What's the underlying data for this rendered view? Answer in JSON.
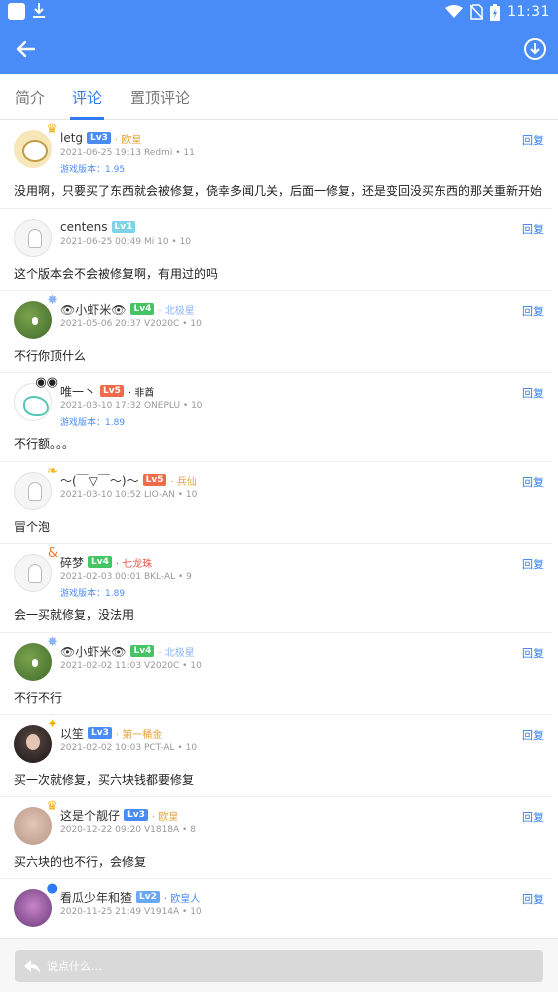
{
  "status_bar": {
    "time": "11:31"
  },
  "tabs": [
    "简介",
    "评论",
    "置顶评论"
  ],
  "active_tab": "评论",
  "reply_label": "回复",
  "input": {
    "placeholder": "说点什么..."
  },
  "colors": {
    "primary": "#4a8cf7",
    "accent": "#2f7bf2",
    "gold": "#e6a23c",
    "black": "#222222",
    "red": "#e35b4b"
  },
  "comments": [
    {
      "user": "letg",
      "level": "Lv3",
      "level_color": "#4a8cf7",
      "title": "· 欧皇",
      "title_color": "#e6a23c",
      "meta": "2021-06-25 19:13 Redmi  • 11",
      "version": "游戏版本：1.95",
      "content": "没用啊，只要买了东西就会被修复，侥幸多闻几关，后面一修复，还是变回没买东西的那关重新开始",
      "avatar": "cartoon",
      "decor": "crown"
    },
    {
      "user": "centens",
      "level": "Lv1",
      "level_color": "#7fd3e6",
      "title": "",
      "title_color": "#999999",
      "meta": "2021-06-25 00:49 Mi 10 • 10",
      "version": "",
      "content": "这个版本会不会被修复啊，有用过的吗",
      "avatar": "ghost",
      "decor": ""
    },
    {
      "user": "👁小虾米👁",
      "level": "Lv4",
      "level_color": "#45c463",
      "title": "· 北极星",
      "title_color": "#8ab4f8",
      "meta": "2021-05-06 20:37 V2020C • 10",
      "version": "",
      "content": "不行你顶什么",
      "avatar": "green",
      "decor": "star"
    },
    {
      "user": "唯一丶",
      "level": "Lv5",
      "level_color": "#ef6b4a",
      "title": "· 非酋",
      "title_color": "#222222",
      "meta": "2021-03-10 17:32 ONEPLU • 10",
      "version": "游戏版本：1.89",
      "content": "不行额。。。",
      "avatar": "teal",
      "decor": "eyes"
    },
    {
      "user": "～(￣▽￣～)～",
      "level": "Lv5",
      "level_color": "#ef6b4a",
      "title": "· 兵仙",
      "title_color": "#e6a23c",
      "meta": "2021-03-10 10:52 LIO-AN • 10",
      "version": "",
      "content": "冒个泡",
      "avatar": "ghost",
      "decor": "wing"
    },
    {
      "user": "碎梦",
      "level": "Lv4",
      "level_color": "#45c463",
      "title": "· 七龙珠",
      "title_color": "#e35b4b",
      "meta": "2021-02-03 00:01 BKL-AL • 9",
      "version": "游戏版本：1.89",
      "content": "会一买就修复，没法用",
      "avatar": "ghost",
      "decor": "amp"
    },
    {
      "user": "👁小虾米👁",
      "level": "Lv4",
      "level_color": "#45c463",
      "title": "· 北极星",
      "title_color": "#8ab4f8",
      "meta": "2021-02-02 11:03 V2020C • 10",
      "version": "",
      "content": "不行不行",
      "avatar": "green",
      "decor": "star"
    },
    {
      "user": "以笙",
      "level": "Lv3",
      "level_color": "#4a8cf7",
      "title": "· 第一桶金",
      "title_color": "#e6a23c",
      "meta": "2021-02-02 10:03 PCT-AL • 10",
      "version": "",
      "content": "买一次就修复，买六块钱都要修复",
      "avatar": "dark",
      "decor": "spark"
    },
    {
      "user": "这是个靓仔",
      "level": "Lv3",
      "level_color": "#4a8cf7",
      "title": "· 欧皇",
      "title_color": "#e6a23c",
      "meta": "2020-12-22 09:20 V1818A • 8",
      "version": "",
      "content": "买六块的也不行，会修复",
      "avatar": "girl",
      "decor": "crown"
    },
    {
      "user": "看瓜少年和猹",
      "level": "Lv2",
      "level_color": "#6aa8f5",
      "title": "· 欧皇人",
      "title_color": "#4a8cf7",
      "meta": "2020-11-25 21:49 V1914A • 10",
      "version": "",
      "content": "",
      "avatar": "pink",
      "decor": "ghostblue"
    }
  ]
}
